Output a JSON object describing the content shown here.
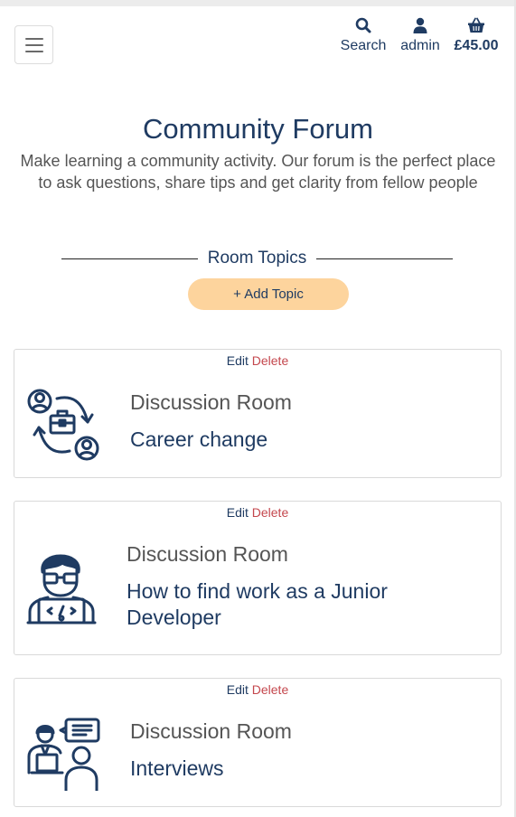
{
  "nav": {
    "search_label": "Search",
    "account_label": "admin",
    "bag_total": "£45.00"
  },
  "hero": {
    "title": "Community Forum",
    "subtitle": "Make learning a community activity. Our forum is the perfect place to ask questions, share tips and get clarity from fellow people"
  },
  "topics": {
    "heading": "Room Topics",
    "add_label": "+ Add Topic"
  },
  "rooms": [
    {
      "edit": "Edit",
      "delete": "Delete",
      "title": "Discussion Room",
      "topic": "Career change",
      "icon": "career-change-icon"
    },
    {
      "edit": "Edit",
      "delete": "Delete",
      "title": "Discussion Room",
      "topic": "How to find work as a Junior Developer",
      "icon": "developer-icon"
    },
    {
      "edit": "Edit",
      "delete": "Delete",
      "title": "Discussion Room",
      "topic": "Interviews",
      "icon": "interview-icon"
    }
  ],
  "colors": {
    "primary": "#1f3b62",
    "accent_button": "#fdd49d",
    "delete": "#c4474d",
    "muted_text": "#555555"
  }
}
